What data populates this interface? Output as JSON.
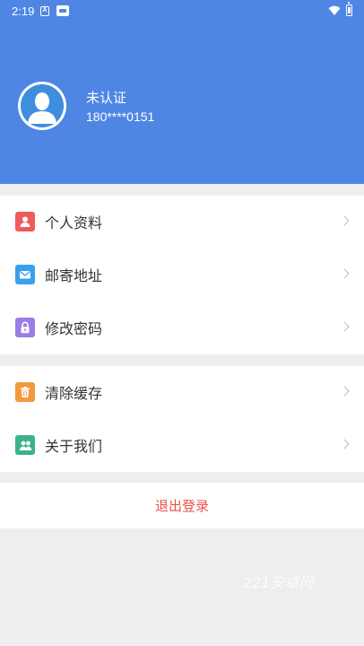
{
  "status_bar": {
    "time": "2:19",
    "notif_icon_1": "a-box-icon",
    "notif_icon_2": "image-icon",
    "wifi_icon": "wifi-icon",
    "battery_icon": "battery-icon"
  },
  "profile": {
    "avatar_icon": "default-user-avatar-icon",
    "name": "未认证",
    "phone": "180****0151"
  },
  "menu_group_1": [
    {
      "label": "个人资料",
      "icon": "person-card-icon",
      "color": "#ef5a5a"
    },
    {
      "label": "邮寄地址",
      "icon": "mail-icon",
      "color": "#3aa0ee"
    },
    {
      "label": "修改密码",
      "icon": "lock-icon",
      "color": "#9b7be6"
    }
  ],
  "menu_group_2": [
    {
      "label": "清除缓存",
      "icon": "trash-icon",
      "color": "#f39a3e"
    },
    {
      "label": "关于我们",
      "icon": "people-icon",
      "color": "#3bb38a"
    }
  ],
  "logout": {
    "label": "退出登录",
    "color": "#e5534b"
  },
  "watermark": "221安卓网",
  "colors": {
    "header": "#4f86e4",
    "background": "#eeeef0"
  }
}
